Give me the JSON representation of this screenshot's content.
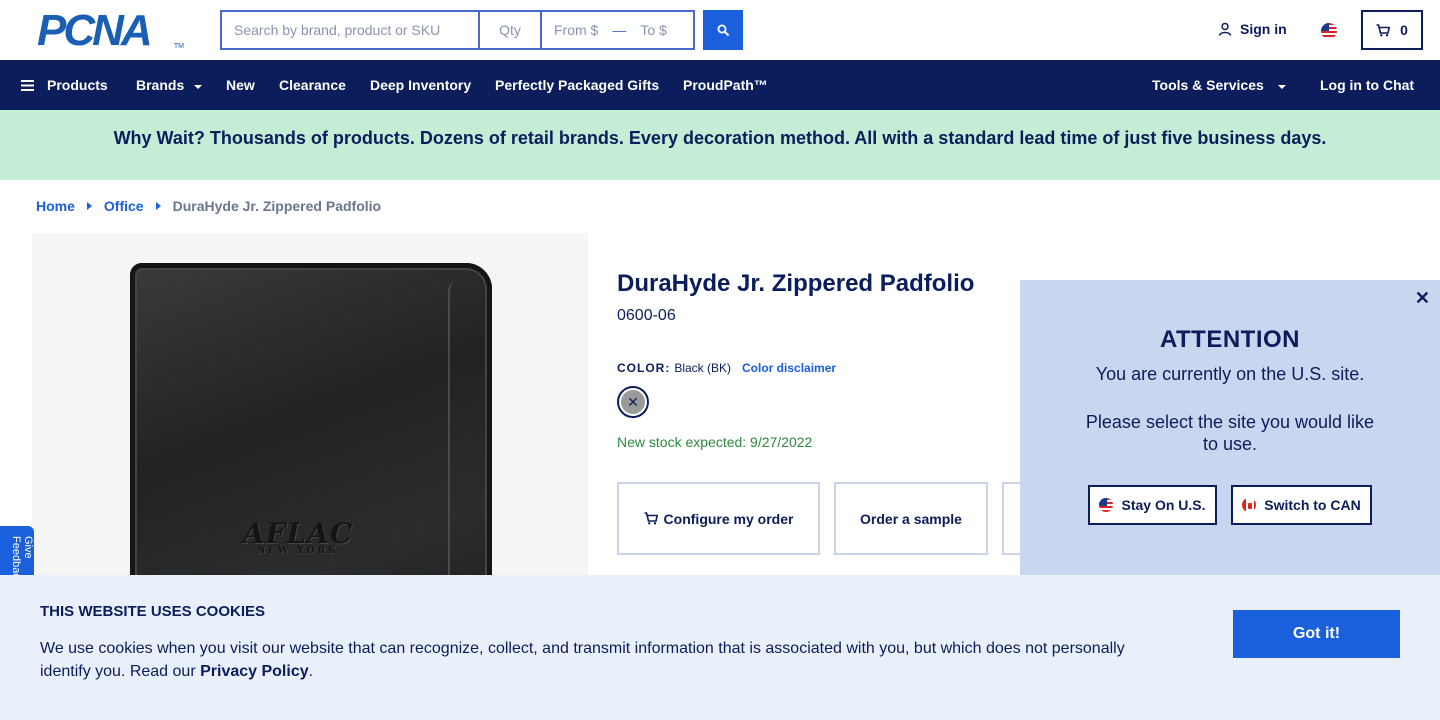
{
  "header": {
    "logo_text": "PCNA",
    "logo_tm": "TM",
    "search_placeholder": "Search by brand, product or SKU",
    "qty_placeholder": "Qty",
    "price_from_placeholder": "From $",
    "price_to_placeholder": "To $",
    "sign_in": "Sign in",
    "cart_count": "0"
  },
  "nav": {
    "products": "Products",
    "brands": "Brands",
    "new": "New",
    "clearance": "Clearance",
    "deep_inventory": "Deep Inventory",
    "gifts": "Perfectly Packaged Gifts",
    "proudpath": "ProudPath™",
    "tools": "Tools & Services",
    "chat": "Log in to Chat"
  },
  "promo": "Why Wait? Thousands of products. Dozens of retail brands. Every decoration method. All with a standard lead time of just five business days.",
  "breadcrumb": {
    "home": "Home",
    "office": "Office",
    "current": "DuraHyde Jr. Zippered Padfolio"
  },
  "product": {
    "image_imprint": "AFLAC",
    "image_imprint_sub": "NEW YORK",
    "title": "DuraHyde Jr. Zippered Padfolio",
    "sku": "0600-06",
    "color_label": "COLOR:",
    "color_value": "Black (BK)",
    "color_disclaimer": "Color disclaimer",
    "stock_note": "New stock expected: 9/27/2022",
    "configure": "Configure my order",
    "sample": "Order a sample"
  },
  "feedback_tab": "Give Feedback",
  "modal": {
    "title": "ATTENTION",
    "line1": "You are currently on the U.S. site.",
    "line2": "Please select the site you would like to use.",
    "stay": "Stay On U.S.",
    "switch": "Switch to CAN",
    "close": "✕"
  },
  "cookie": {
    "title": "THIS WEBSITE USES COOKIES",
    "text": "We use cookies when you visit our website that can recognize, collect, and transmit information that is associated with you, but which does not personally identify you. Read our ",
    "link": "Privacy Policy",
    "end": ".",
    "button": "Got it!"
  },
  "colors": {
    "navy": "#0b1d5b",
    "accent_blue": "#1a5fdb",
    "promo_green": "#c4edd6",
    "modal_bg": "#c9d6ef",
    "cookie_bg": "#e9f0fb",
    "stock_green": "#2b8a3e"
  }
}
